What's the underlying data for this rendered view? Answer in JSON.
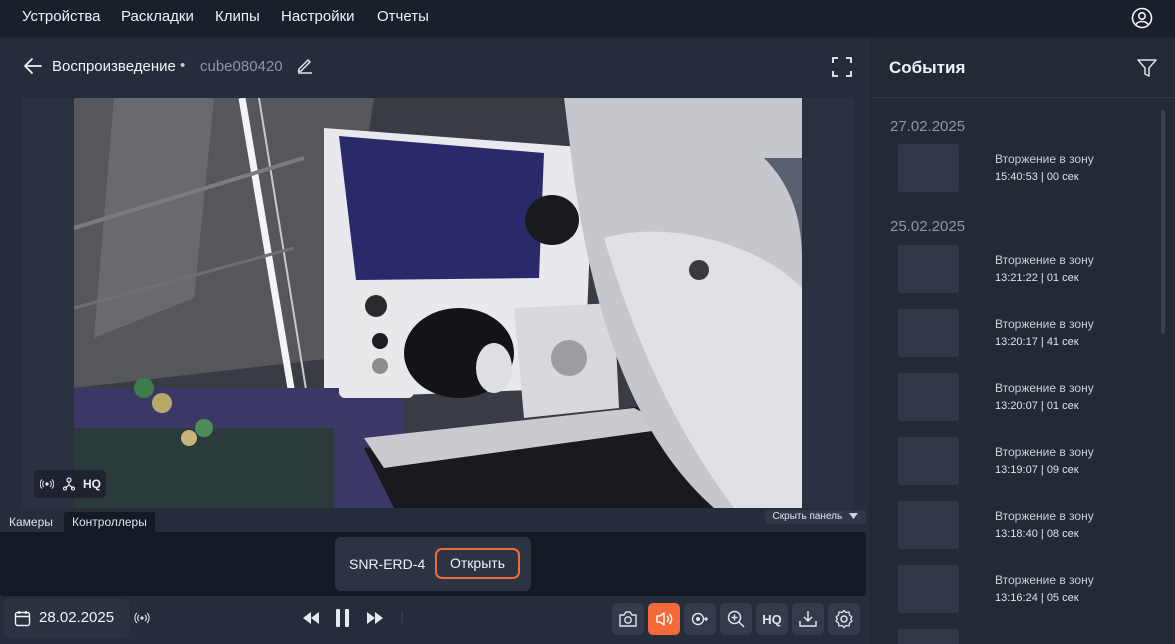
{
  "nav": {
    "items": [
      "Устройства",
      "Раскладки",
      "Клипы",
      "Настройки",
      "Отчеты"
    ],
    "user_icon": "user-circle-icon"
  },
  "breadcrumb": {
    "title": "Воспроизведение",
    "separator": "•",
    "camera": "cube080420"
  },
  "video": {
    "overlay_hq": "HQ"
  },
  "panel": {
    "tabs": [
      "Камеры",
      "Контроллеры"
    ],
    "active_tab": "Контроллеры",
    "hide_label": "Скрыть панель",
    "controller_name": "SNR-ERD-4",
    "open_label": "Открыть"
  },
  "toolbar": {
    "date": "28.02.2025",
    "hq_label": "HQ",
    "buttons": [
      "camera-snapshot-icon",
      "sound-icon",
      "video-record-icon",
      "zoom-in-icon",
      "hq",
      "download-icon",
      "settings-icon"
    ],
    "active_button": "sound-icon"
  },
  "events": {
    "title": "События",
    "groups": [
      {
        "date": "27.02.2025",
        "items": [
          {
            "title": "Вторжение в зону",
            "time": "15:40:53",
            "duration": "00 сек"
          }
        ]
      },
      {
        "date": "25.02.2025",
        "items": [
          {
            "title": "Вторжение в зону",
            "time": "13:21:22",
            "duration": "01 сек"
          },
          {
            "title": "Вторжение в зону",
            "time": "13:20:17",
            "duration": "41 сек"
          },
          {
            "title": "Вторжение в зону",
            "time": "13:20:07",
            "duration": "01 сек"
          },
          {
            "title": "Вторжение в зону",
            "time": "13:19:07",
            "duration": "09 сек"
          },
          {
            "title": "Вторжение в зону",
            "time": "13:18:40",
            "duration": "08 сек"
          },
          {
            "title": "Вторжение в зону",
            "time": "13:16:24",
            "duration": "05 сек"
          }
        ]
      }
    ]
  },
  "colors": {
    "accent": "#f26a3a",
    "background": "#1d2431",
    "panel": "#141a25"
  }
}
